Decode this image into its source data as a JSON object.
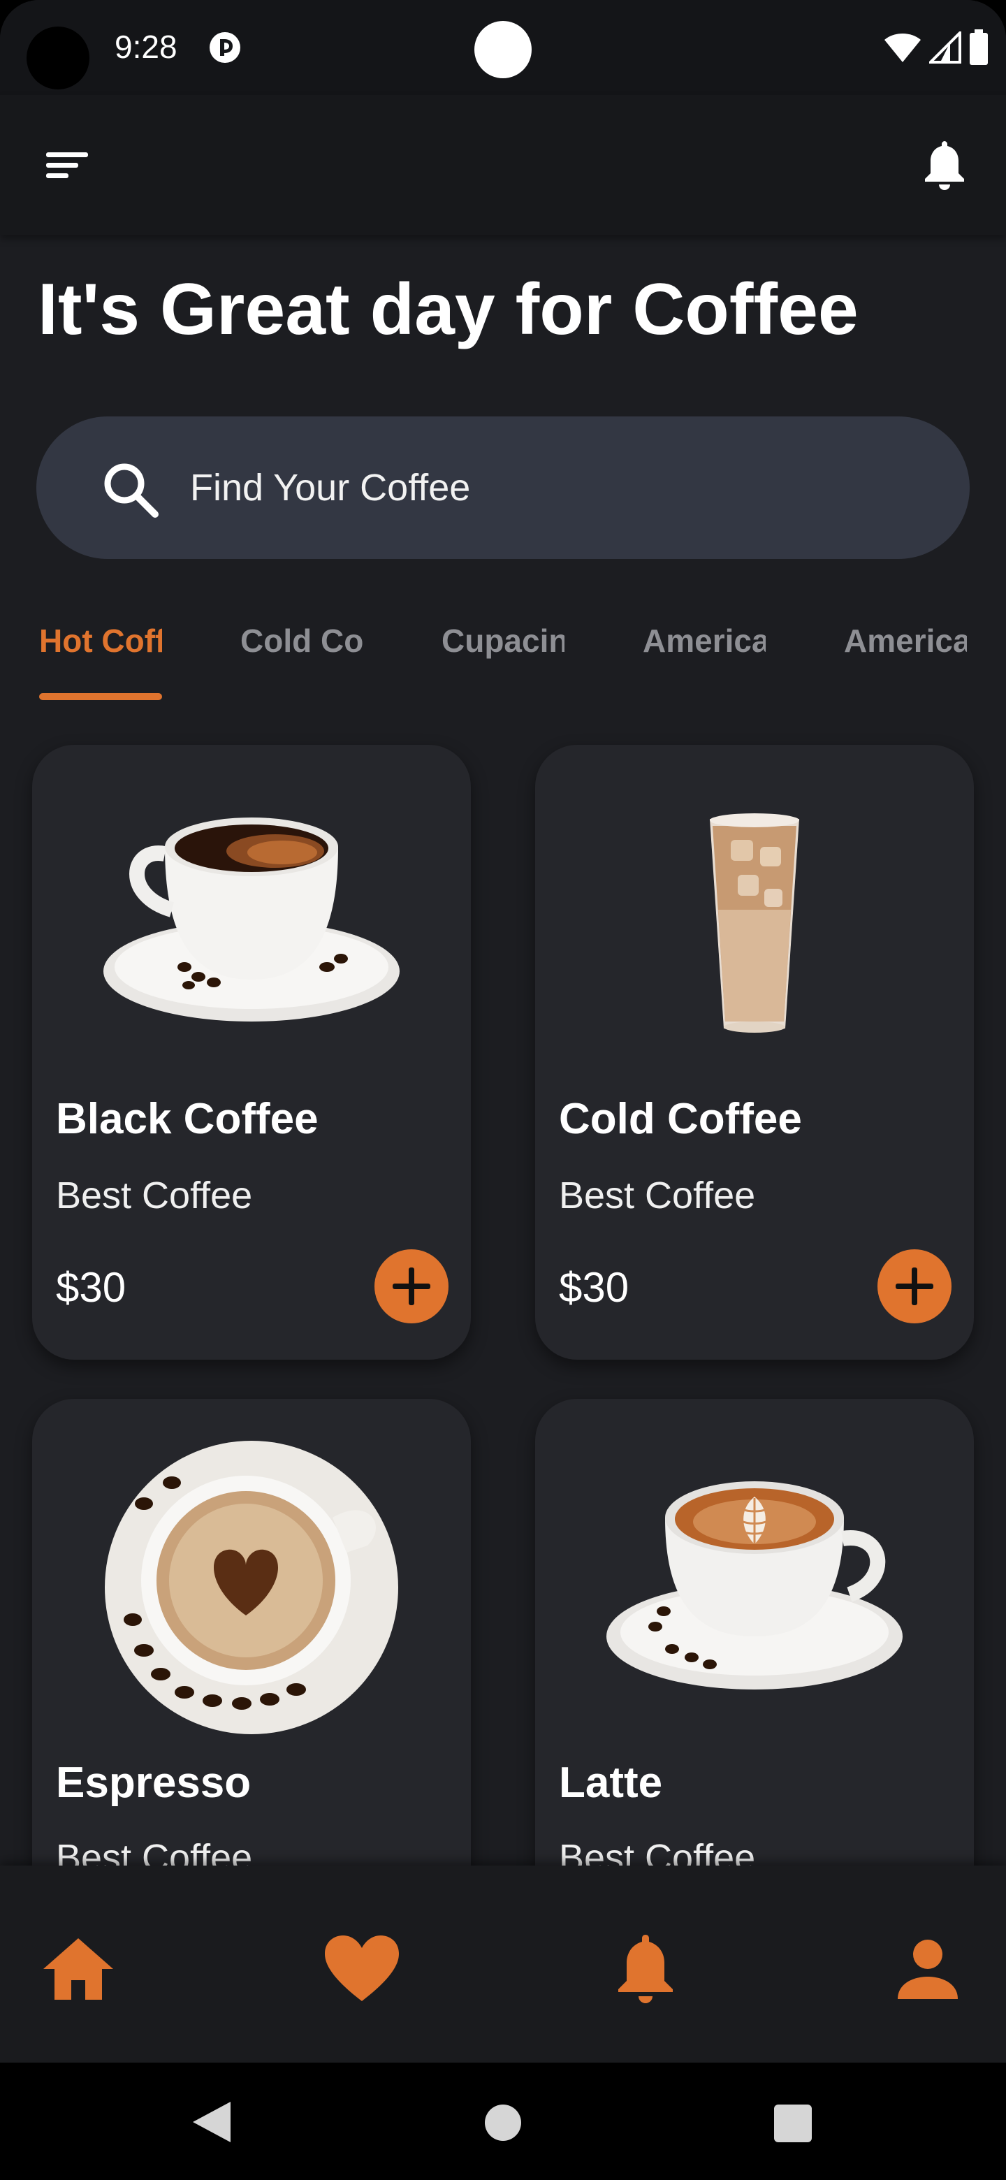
{
  "status_bar": {
    "time": "9:28",
    "icons": [
      "app-notification-icon",
      "wifi-icon",
      "signal-icon",
      "battery-icon"
    ]
  },
  "app_bar": {
    "menu_icon": "menu-icon",
    "notification_icon": "bell-icon"
  },
  "headline": "It's Great day for Coffee",
  "search": {
    "placeholder": "Find Your Coffee",
    "icon": "search-icon"
  },
  "tabs": [
    {
      "label": "Hot Coffee",
      "active": true
    },
    {
      "label": "Cold Coffee",
      "active": false
    },
    {
      "label": "Cupacino",
      "active": false
    },
    {
      "label": "Americano",
      "active": false
    },
    {
      "label": "Americano",
      "active": false
    }
  ],
  "products": [
    {
      "name": "Black Coffee",
      "subtitle": "Best Coffee",
      "price": "$30",
      "image": "black-coffee-cup"
    },
    {
      "name": "Cold Coffee",
      "subtitle": "Best Coffee",
      "price": "$30",
      "image": "iced-coffee-glass"
    },
    {
      "name": "Espresso",
      "subtitle": "Best Coffee",
      "price": "",
      "image": "espresso-heart-cup"
    },
    {
      "name": "Latte",
      "subtitle": "Best Coffee",
      "price": "",
      "image": "latte-art-cup"
    }
  ],
  "bottom_nav": [
    "home-icon",
    "heart-icon",
    "bell-icon",
    "person-icon"
  ],
  "colors": {
    "accent": "#e0742e",
    "background": "#1c1d21",
    "card": "#25262b",
    "search_bg": "#333743",
    "inactive_tab": "#8e8f94"
  }
}
